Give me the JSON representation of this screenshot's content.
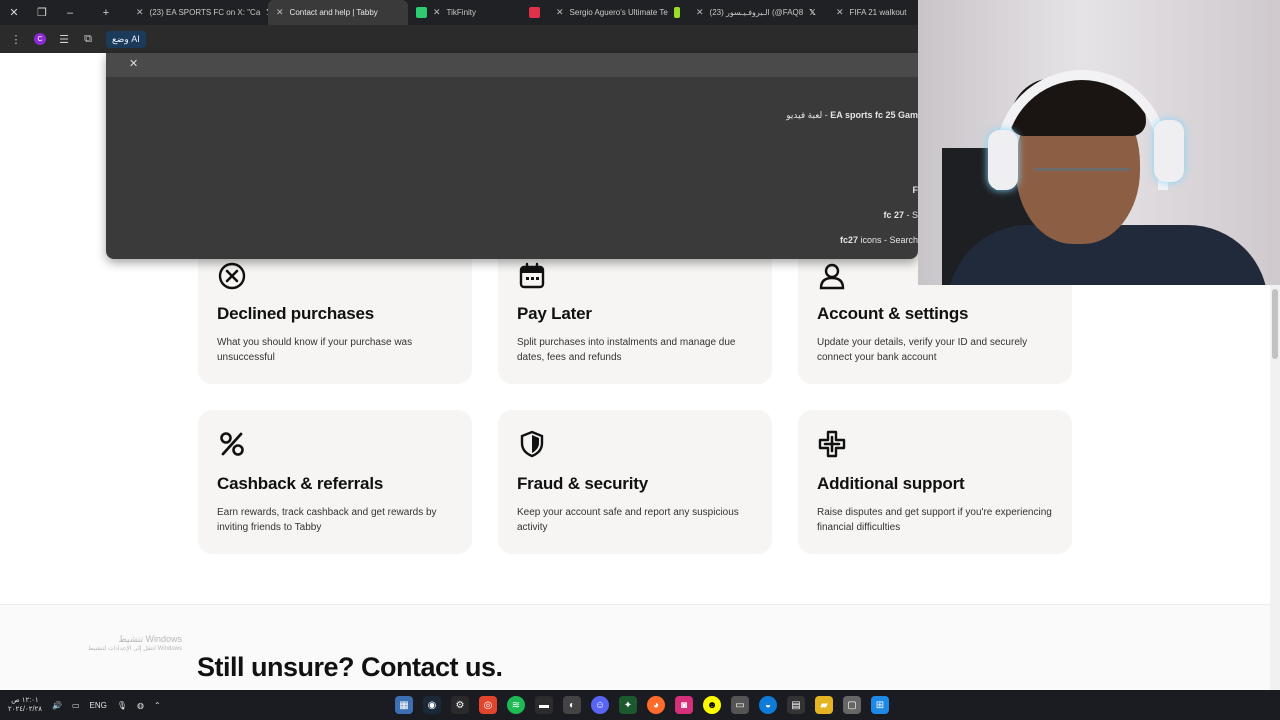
{
  "browser": {
    "tabs": [
      {
        "title": "(23) EA SPORTS FC on X: \"Ca",
        "icon": "x-logo-icon",
        "active": false
      },
      {
        "title": "Contact and help | Tabby",
        "icon": "tabby-icon",
        "active": true
      },
      {
        "title": "TikFinity",
        "icon": "tikfinity-icon",
        "active": false
      },
      {
        "title": "Sergio Aguero's Ultimate Te",
        "icon": "futbin-icon",
        "active": false
      },
      {
        "title": "(23) الـبروفـيـسور (@FAQ8",
        "icon": "x-logo-icon",
        "active": false
      },
      {
        "title": "FIFA 21 walkout -",
        "icon": "x-logo-icon",
        "active": false
      }
    ],
    "toolbar": {
      "ai_chip": "وضع AI",
      "extension_letter": "C"
    },
    "omnibox": {
      "suggestions": [
        {
          "bold": "EA sports fc 25 Gam",
          "rest": "لعبة فيديو  -  "
        },
        {
          "bold": "F",
          "rest": ""
        },
        {
          "bold": "fc 27",
          "rest": " - S"
        },
        {
          "bold": "fc27",
          "rest": " icons - Search"
        }
      ]
    }
  },
  "cards": [
    {
      "title": "Declined purchases",
      "desc": "What you should know if your purchase was unsuccessful",
      "icon": "declined-x-circle-icon"
    },
    {
      "title": "Pay Later",
      "desc": "Split purchases into instalments and manage due dates, fees and refunds",
      "icon": "calendar-icon"
    },
    {
      "title": "Account & settings",
      "desc": "Update your details, verify your ID and securely connect your bank account",
      "icon": "user-icon"
    },
    {
      "title": "Cashback & referrals",
      "desc": "Earn rewards, track cashback and get rewards by inviting friends to Tabby",
      "icon": "percent-icon"
    },
    {
      "title": "Fraud & security",
      "desc": "Keep your account safe and report any suspicious activity",
      "icon": "shield-icon"
    },
    {
      "title": "Additional support",
      "desc": "Raise disputes and get support if you're experiencing financial difficulties",
      "icon": "plus-cross-icon"
    }
  ],
  "contact_heading": "Still unsure? Contact us.",
  "watermark": {
    "title": "تنشيط Windows",
    "subtitle": "انتقل إلى الإعدادات لتنشيط Windows"
  },
  "taskbar": {
    "time": "١٢:٠١ ص",
    "date": "٢٠٢٤/٠٢/٢٨",
    "language": "ENG"
  },
  "colors": {
    "card_bg": "#f6f5f3",
    "browser_dark": "#202124",
    "omnibox_bg": "#3a3a3a"
  }
}
